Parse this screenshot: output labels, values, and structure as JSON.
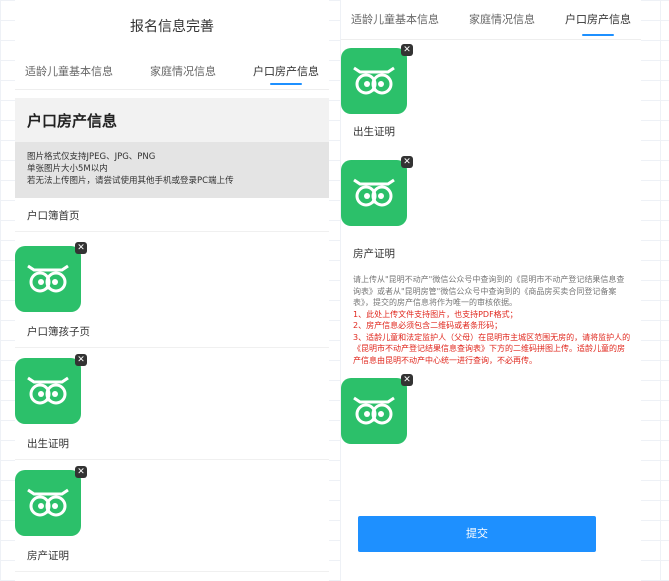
{
  "left": {
    "title": "报名信息完善",
    "tabs": [
      "适龄儿童基本信息",
      "家庭情况信息",
      "户口房产信息"
    ],
    "section_title": "户口房产信息",
    "notes": [
      "图片格式仅支持JPEG、JPG、PNG",
      "单张图片大小5M以内",
      "若无法上传图片，请尝试使用其他手机或登录PC端上传"
    ],
    "uploads": [
      "户口簿首页",
      "户口簿孩子页",
      "出生证明",
      "房产证明"
    ]
  },
  "right": {
    "tabs": [
      "适龄儿童基本信息",
      "家庭情况信息",
      "户口房产信息"
    ],
    "label_birth": "出生证明",
    "label_property": "房产证明",
    "explain_gray": "请上传从\"昆明不动产\"微信公众号中查询到的《昆明市不动产登记结果信息查询表》或者从\"昆明房管\"微信公众号中查询到的《商品房买卖合同登记备案表》，提交的房产信息将作为唯一的审核依据。",
    "explain_red": [
      "1、此处上传文件支持图片，也支持PDF格式；",
      "2、房产信息必须包含二维码或者条形码；",
      "3、适龄儿童和法定监护人（父母）在昆明市主城区范围无房的，请将监护人的《昆明市不动产登记结果信息查询表》下方的二维码拼图上传。适龄儿童的房产信息由昆明不动产中心统一进行查询，不必再传。"
    ],
    "submit_label": "提交"
  },
  "colors": {
    "accent": "#1e90ff",
    "thumb_green": "#2cc06a",
    "warning_red": "#e0271d"
  },
  "icons": {
    "thumb": "owl-logo-icon",
    "delete": "close-icon"
  }
}
